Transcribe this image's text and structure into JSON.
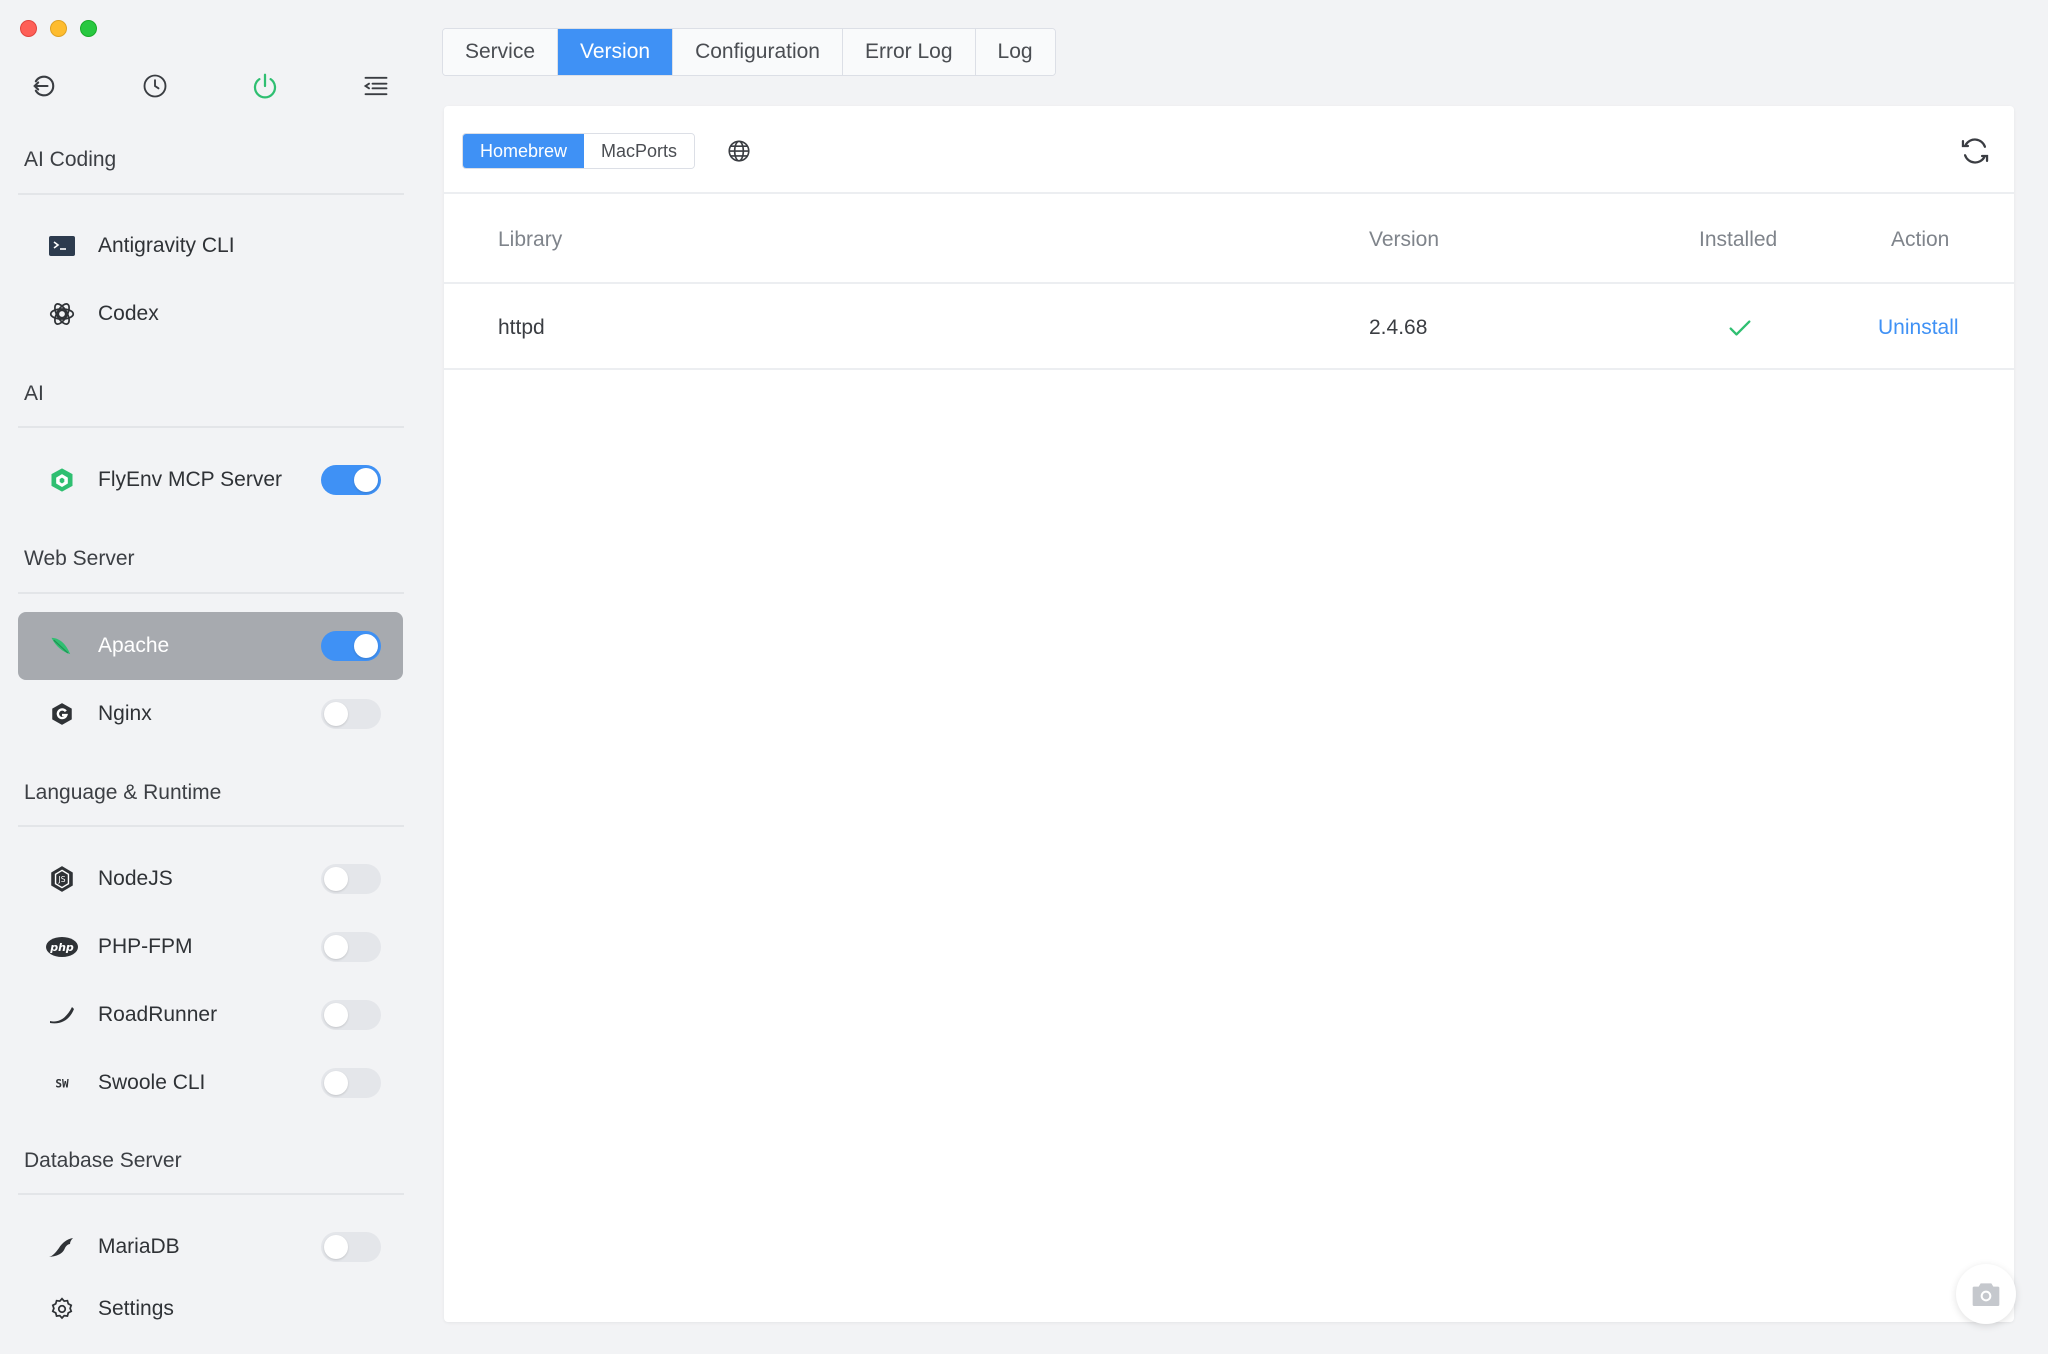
{
  "sidebar": {
    "top_icons": [
      "back-icon",
      "history-icon",
      "power-icon",
      "menu-icon"
    ],
    "sections": [
      {
        "title": "AI Coding",
        "items": [
          {
            "label": "Antigravity CLI",
            "icon": "terminal-icon",
            "toggle": null
          },
          {
            "label": "Codex",
            "icon": "openai-icon",
            "toggle": null
          }
        ]
      },
      {
        "title": "AI",
        "items": [
          {
            "label": "FlyEnv MCP Server",
            "icon": "cube-icon",
            "toggle": true
          }
        ]
      },
      {
        "title": "Web Server",
        "items": [
          {
            "label": "Apache",
            "icon": "feather-icon",
            "toggle": true,
            "active": true
          },
          {
            "label": "Nginx",
            "icon": "nginx-icon",
            "toggle": false
          }
        ]
      },
      {
        "title": "Language & Runtime",
        "items": [
          {
            "label": "NodeJS",
            "icon": "nodejs-icon",
            "toggle": false
          },
          {
            "label": "PHP-FPM",
            "icon": "php-icon",
            "toggle": false
          },
          {
            "label": "RoadRunner",
            "icon": "roadrunner-icon",
            "toggle": false
          },
          {
            "label": "Swoole CLI",
            "icon": "swoole-icon",
            "toggle": false
          }
        ]
      },
      {
        "title": "Database Server",
        "items": [
          {
            "label": "MariaDB",
            "icon": "seal-icon",
            "toggle": false
          },
          {
            "label": "Settings",
            "icon": "gear-icon",
            "toggle": null
          }
        ]
      }
    ]
  },
  "tabs": [
    "Service",
    "Version",
    "Configuration",
    "Error Log",
    "Log"
  ],
  "active_tab": "Version",
  "sources": [
    "Homebrew",
    "MacPorts"
  ],
  "active_source": "Homebrew",
  "table": {
    "columns": {
      "library": "Library",
      "version": "Version",
      "installed": "Installed",
      "action": "Action"
    },
    "rows": [
      {
        "library": "httpd",
        "version": "2.4.68",
        "installed": true,
        "action": "Uninstall"
      }
    ]
  },
  "colors": {
    "accent": "#3f91f5",
    "success": "#2fbf71",
    "active_item": "#a7aaaf"
  }
}
